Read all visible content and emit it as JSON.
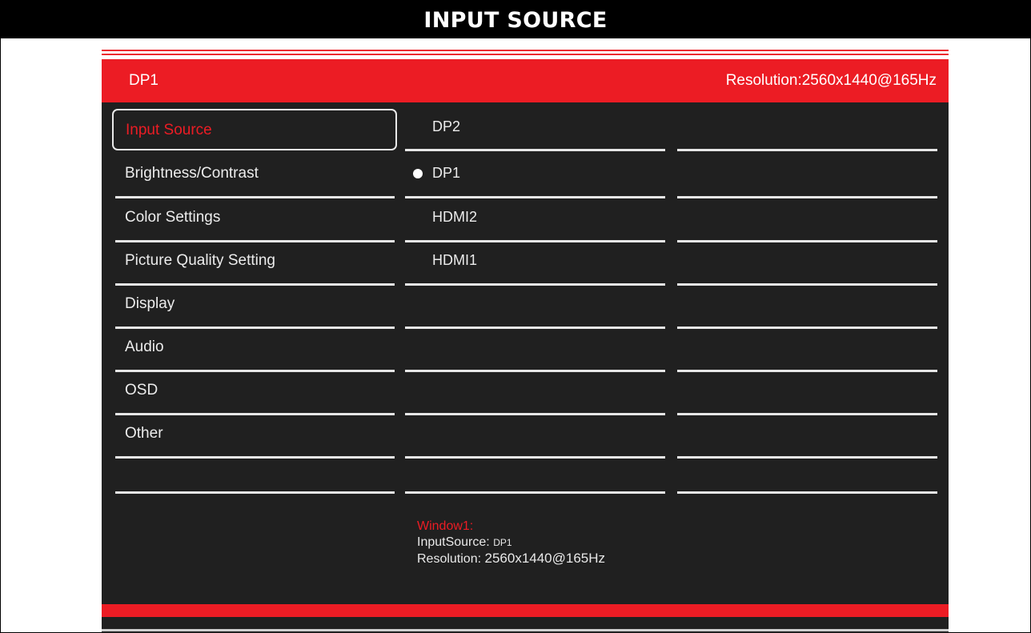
{
  "title": "INPUT SOURCE",
  "header": {
    "source": "DP1",
    "resolution": "Resolution:2560x1440@165Hz"
  },
  "menu": [
    {
      "label": "Input Source",
      "selected": true
    },
    {
      "label": "Brightness/Contrast"
    },
    {
      "label": "Color Settings"
    },
    {
      "label": "Picture Quality Setting"
    },
    {
      "label": "Display"
    },
    {
      "label": "Audio"
    },
    {
      "label": "OSD"
    },
    {
      "label": "Other"
    },
    {
      "label": ""
    }
  ],
  "sources": [
    {
      "label": "DP2"
    },
    {
      "label": "DP1",
      "active": true
    },
    {
      "label": "HDMI2"
    },
    {
      "label": "HDMI1"
    }
  ],
  "info": {
    "title": "Window1:",
    "input_label": "InputSource:",
    "input_value": "DP1",
    "resolution_label": "Resolution:",
    "resolution_value": "2560x1440@165Hz"
  },
  "colors": {
    "accent": "#ec1c24",
    "panel": "#202020",
    "text": "#ececec"
  }
}
